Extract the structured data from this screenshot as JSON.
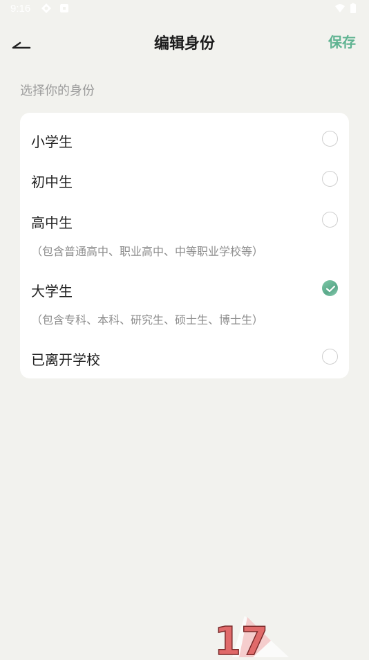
{
  "status_bar": {
    "time": "9:16",
    "left_icons": [
      "sync-icon",
      "notification-icon"
    ],
    "right_icons": [
      "wifi-icon",
      "battery-icon"
    ]
  },
  "header": {
    "back_icon": "back-arrow-icon",
    "title": "编辑身份",
    "save_label": "保存",
    "accent_color": "#5fb391"
  },
  "section_label": "选择你的身份",
  "options": [
    {
      "label": "小学生",
      "note": "",
      "selected": false
    },
    {
      "label": "初中生",
      "note": "",
      "selected": false
    },
    {
      "label": "高中生",
      "note": "（包含普通高中、职业高中、中等职业学校等）",
      "selected": false
    },
    {
      "label": "大学生",
      "note": "（包含专科、本科、研究生、硕士生、博士生）",
      "selected": true
    },
    {
      "label": "已离开学校",
      "note": "",
      "selected": false
    }
  ],
  "watermark": {
    "text": "17",
    "color": "#e06a6a"
  }
}
